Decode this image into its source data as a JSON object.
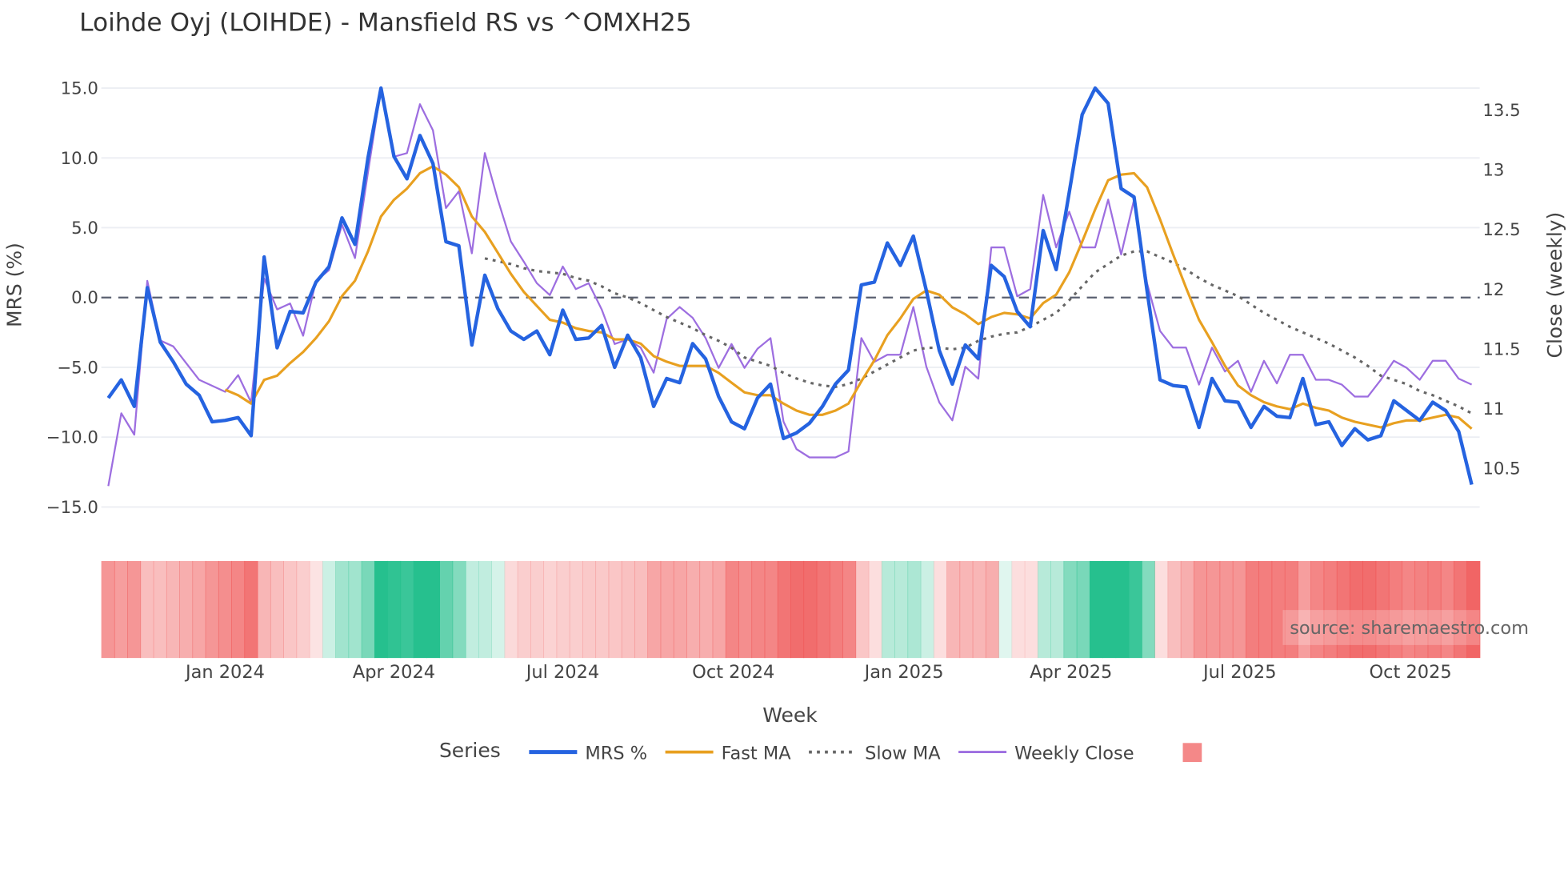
{
  "chart_data": {
    "type": "line",
    "title": "Loihde Oyj (LOIHDE) - Mansfield RS vs ^OMXH25",
    "xlabel": "Week",
    "ylabel": "MRS (%)",
    "y2label": "Close (weekly)",
    "first_week": "2023-10-30",
    "ylim": [
      -17.01,
      17.01
    ],
    "y2lim": [
      9.94,
      13.92
    ],
    "yticks": [
      15,
      10,
      5,
      0,
      -5,
      -10,
      -15
    ],
    "ytick_labels": [
      "15.0",
      "10.0",
      "5.0",
      "0.0",
      "−5.0",
      "−10.0",
      "−15.0"
    ],
    "y2ticks": [
      13.5,
      13,
      12.5,
      12,
      11.5,
      11,
      10.5
    ],
    "y2tick_labels": [
      "13.5",
      "13",
      "12.5",
      "12",
      "11.5",
      "11",
      "10.5"
    ],
    "xticks": [
      {
        "date": "2024-01-01",
        "label": "Jan 2024"
      },
      {
        "date": "2024-04-01",
        "label": "Apr 2024"
      },
      {
        "date": "2024-07-01",
        "label": "Jul 2024"
      },
      {
        "date": "2024-10-01",
        "label": "Oct 2024"
      },
      {
        "date": "2025-01-01",
        "label": "Jan 2025"
      },
      {
        "date": "2025-04-01",
        "label": "Apr 2025"
      },
      {
        "date": "2025-07-01",
        "label": "Jul 2025"
      },
      {
        "date": "2025-10-01",
        "label": "Oct 2025"
      }
    ],
    "zero_line": 0,
    "grid": true,
    "legend_title": "Series",
    "legend_placement": "bottom",
    "series": [
      {
        "name": "MRS %",
        "axis": "left",
        "color": "#2563e0",
        "start_index": 0,
        "values": [
          -7.2,
          -5.9,
          -7.8,
          0.7,
          -3.2,
          -4.6,
          -6.2,
          -7.0,
          -8.9,
          -8.8,
          -8.6,
          -9.9,
          2.9,
          -3.6,
          -1.0,
          -1.1,
          1.1,
          2.2,
          5.7,
          3.8,
          10.0,
          15.0,
          10.1,
          8.5,
          11.6,
          9.6,
          4.0,
          3.7,
          -3.4,
          1.6,
          -0.8,
          -2.4,
          -3.0,
          -2.4,
          -4.1,
          -0.9,
          -3.0,
          -2.9,
          -2.0,
          -5.0,
          -2.7,
          -4.3,
          -7.8,
          -5.8,
          -6.1,
          -3.3,
          -4.4,
          -7.1,
          -8.9,
          -9.4,
          -7.2,
          -6.2,
          -10.1,
          -9.7,
          -9.0,
          -7.8,
          -6.2,
          -5.2,
          0.9,
          1.1,
          3.9,
          2.3,
          4.4,
          0.5,
          -3.8,
          -6.2,
          -3.4,
          -4.4,
          2.3,
          1.5,
          -1.0,
          -2.1,
          4.8,
          2.0,
          7.5,
          13.1,
          15.0,
          13.9,
          7.8,
          7.2,
          0.5,
          -5.9,
          -6.3,
          -6.4,
          -9.3,
          -5.8,
          -7.4,
          -7.5,
          -9.3,
          -7.8,
          -8.5,
          -8.6,
          -5.8,
          -9.1,
          -8.9,
          -10.6,
          -9.4,
          -10.2,
          -9.9,
          -7.4,
          -8.1,
          -8.8,
          -7.5,
          -8.1,
          -9.6,
          -13.4
        ]
      },
      {
        "name": "Fast MA",
        "axis": "left",
        "color": "#e8a020",
        "start_index": 9,
        "values": [
          -6.6,
          -7.0,
          -7.6,
          -5.9,
          -5.6,
          -4.7,
          -3.9,
          -2.9,
          -1.7,
          0.1,
          1.2,
          3.3,
          5.8,
          7.0,
          7.8,
          8.9,
          9.4,
          8.8,
          7.9,
          5.8,
          4.7,
          3.2,
          1.7,
          0.4,
          -0.6,
          -1.6,
          -1.8,
          -2.2,
          -2.4,
          -2.5,
          -3.0,
          -3.0,
          -3.3,
          -4.2,
          -4.6,
          -4.9,
          -4.9,
          -4.9,
          -5.4,
          -6.1,
          -6.8,
          -7.0,
          -7.0,
          -7.6,
          -8.1,
          -8.4,
          -8.4,
          -8.1,
          -7.6,
          -6.0,
          -4.5,
          -2.7,
          -1.5,
          -0.1,
          0.5,
          0.2,
          -0.7,
          -1.2,
          -1.9,
          -1.4,
          -1.1,
          -1.2,
          -1.5,
          -0.4,
          0.2,
          1.8,
          4.0,
          6.3,
          8.4,
          8.8,
          8.9,
          7.9,
          5.6,
          3.1,
          0.7,
          -1.6,
          -3.2,
          -4.9,
          -6.3,
          -7.0,
          -7.5,
          -7.8,
          -8.0,
          -7.6,
          -7.9,
          -8.1,
          -8.6,
          -8.9,
          -9.1,
          -9.3,
          -9.0,
          -8.8,
          -8.8,
          -8.6,
          -8.4,
          -8.6,
          -9.4
        ]
      },
      {
        "name": "Slow MA",
        "axis": "left",
        "color": "#666666",
        "start_index": 29,
        "values": [
          2.8,
          2.6,
          2.4,
          2.1,
          1.9,
          1.8,
          1.7,
          1.4,
          1.2,
          0.8,
          0.3,
          0.0,
          -0.4,
          -0.9,
          -1.4,
          -1.8,
          -2.2,
          -2.7,
          -3.1,
          -3.6,
          -4.3,
          -4.6,
          -4.9,
          -5.4,
          -5.8,
          -6.1,
          -6.3,
          -6.4,
          -6.2,
          -5.8,
          -5.3,
          -4.8,
          -4.3,
          -3.8,
          -3.6,
          -3.6,
          -3.7,
          -3.6,
          -3.1,
          -2.8,
          -2.6,
          -2.5,
          -2.1,
          -1.6,
          -1.1,
          -0.2,
          0.8,
          1.8,
          2.4,
          3.0,
          3.3,
          3.3,
          2.9,
          2.5,
          2.0,
          1.4,
          0.9,
          0.5,
          0.1,
          -0.5,
          -1.1,
          -1.6,
          -2.1,
          -2.5,
          -2.9,
          -3.3,
          -3.8,
          -4.3,
          -4.9,
          -5.6,
          -5.9,
          -6.2,
          -6.7,
          -7.0,
          -7.4,
          -7.8,
          -8.3
        ]
      },
      {
        "name": "Weekly Close",
        "axis": "right",
        "color": "#9d6ee0",
        "start_index": 0,
        "values": [
          10.35,
          10.96,
          10.78,
          12.07,
          11.57,
          11.52,
          11.38,
          11.24,
          11.19,
          11.14,
          11.28,
          11.05,
          12.09,
          11.83,
          11.88,
          11.61,
          12.07,
          12.16,
          12.54,
          12.26,
          12.98,
          13.68,
          13.11,
          13.14,
          13.55,
          13.33,
          12.68,
          12.82,
          12.3,
          13.14,
          12.75,
          12.4,
          12.23,
          12.05,
          11.95,
          12.19,
          12.0,
          12.05,
          11.83,
          11.54,
          11.58,
          11.51,
          11.3,
          11.75,
          11.85,
          11.76,
          11.59,
          11.34,
          11.54,
          11.34,
          11.5,
          11.59,
          10.89,
          10.66,
          10.59,
          10.59,
          10.59,
          10.64,
          11.59,
          11.39,
          11.45,
          11.45,
          11.85,
          11.35,
          11.05,
          10.9,
          11.35,
          11.25,
          12.35,
          12.35,
          11.94,
          12.0,
          12.79,
          12.35,
          12.65,
          12.35,
          12.35,
          12.75,
          12.29,
          12.75,
          12.05,
          11.65,
          11.51,
          11.51,
          11.2,
          11.51,
          11.31,
          11.4,
          11.14,
          11.4,
          11.21,
          11.45,
          11.45,
          11.24,
          11.24,
          11.2,
          11.1,
          11.1,
          11.24,
          11.4,
          11.34,
          11.24,
          11.4,
          11.4,
          11.25,
          11.2
        ]
      }
    ],
    "heatmap": {
      "positive_color": "#26c08e",
      "negative_color": "#ef5555",
      "values": [
        -0.6,
        -0.55,
        -0.6,
        -0.35,
        -0.35,
        -0.4,
        -0.45,
        -0.5,
        -0.6,
        -0.65,
        -0.7,
        -0.8,
        -0.4,
        -0.35,
        -0.3,
        -0.25,
        -0.12,
        0.2,
        0.4,
        0.4,
        0.6,
        1,
        0.95,
        0.9,
        1,
        1,
        0.7,
        0.55,
        0.25,
        0.25,
        0.15,
        -0.18,
        -0.25,
        -0.25,
        -0.22,
        -0.25,
        -0.25,
        -0.28,
        -0.28,
        -0.3,
        -0.33,
        -0.35,
        -0.5,
        -0.5,
        -0.5,
        -0.45,
        -0.45,
        -0.5,
        -0.7,
        -0.65,
        -0.7,
        -0.7,
        -0.8,
        -0.85,
        -0.85,
        -0.8,
        -0.75,
        -0.7,
        -0.3,
        -0.15,
        0.3,
        0.3,
        0.35,
        0.2,
        -0.15,
        -0.4,
        -0.4,
        -0.4,
        -0.45,
        0.1,
        -0.15,
        -0.15,
        0.3,
        0.3,
        0.55,
        0.6,
        1,
        1,
        1,
        0.9,
        0.55,
        -0.15,
        -0.35,
        -0.45,
        -0.6,
        -0.6,
        -0.6,
        -0.6,
        -0.75,
        -0.75,
        -0.75,
        -0.75,
        -0.55,
        -0.7,
        -0.75,
        -0.8,
        -0.85,
        -0.85,
        -0.8,
        -0.75,
        -0.7,
        -0.72,
        -0.75,
        -0.7,
        -0.8,
        -0.9
      ]
    },
    "annotation": "source: sharemaestro.com"
  }
}
